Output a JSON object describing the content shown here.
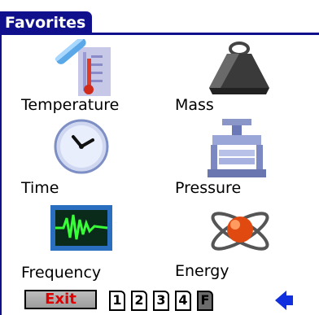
{
  "title": "Favorites",
  "items": [
    {
      "label": "Temperature",
      "icon": "thermometer-icon"
    },
    {
      "label": "Mass",
      "icon": "weight-icon"
    },
    {
      "label": "Time",
      "icon": "clock-icon"
    },
    {
      "label": "Pressure",
      "icon": "press-icon"
    },
    {
      "label": "Frequency",
      "icon": "oscilloscope-icon"
    },
    {
      "label": "Energy",
      "icon": "atom-icon"
    }
  ],
  "toolbar": {
    "exit_label": "Exit",
    "pages": [
      "1",
      "2",
      "3",
      "4",
      "F"
    ],
    "active_page": "F",
    "back_icon": "left-arrow-icon"
  },
  "colors": {
    "title_bar": "#10108c",
    "exit_text": "#e00000",
    "arrow": "#1030e0"
  }
}
